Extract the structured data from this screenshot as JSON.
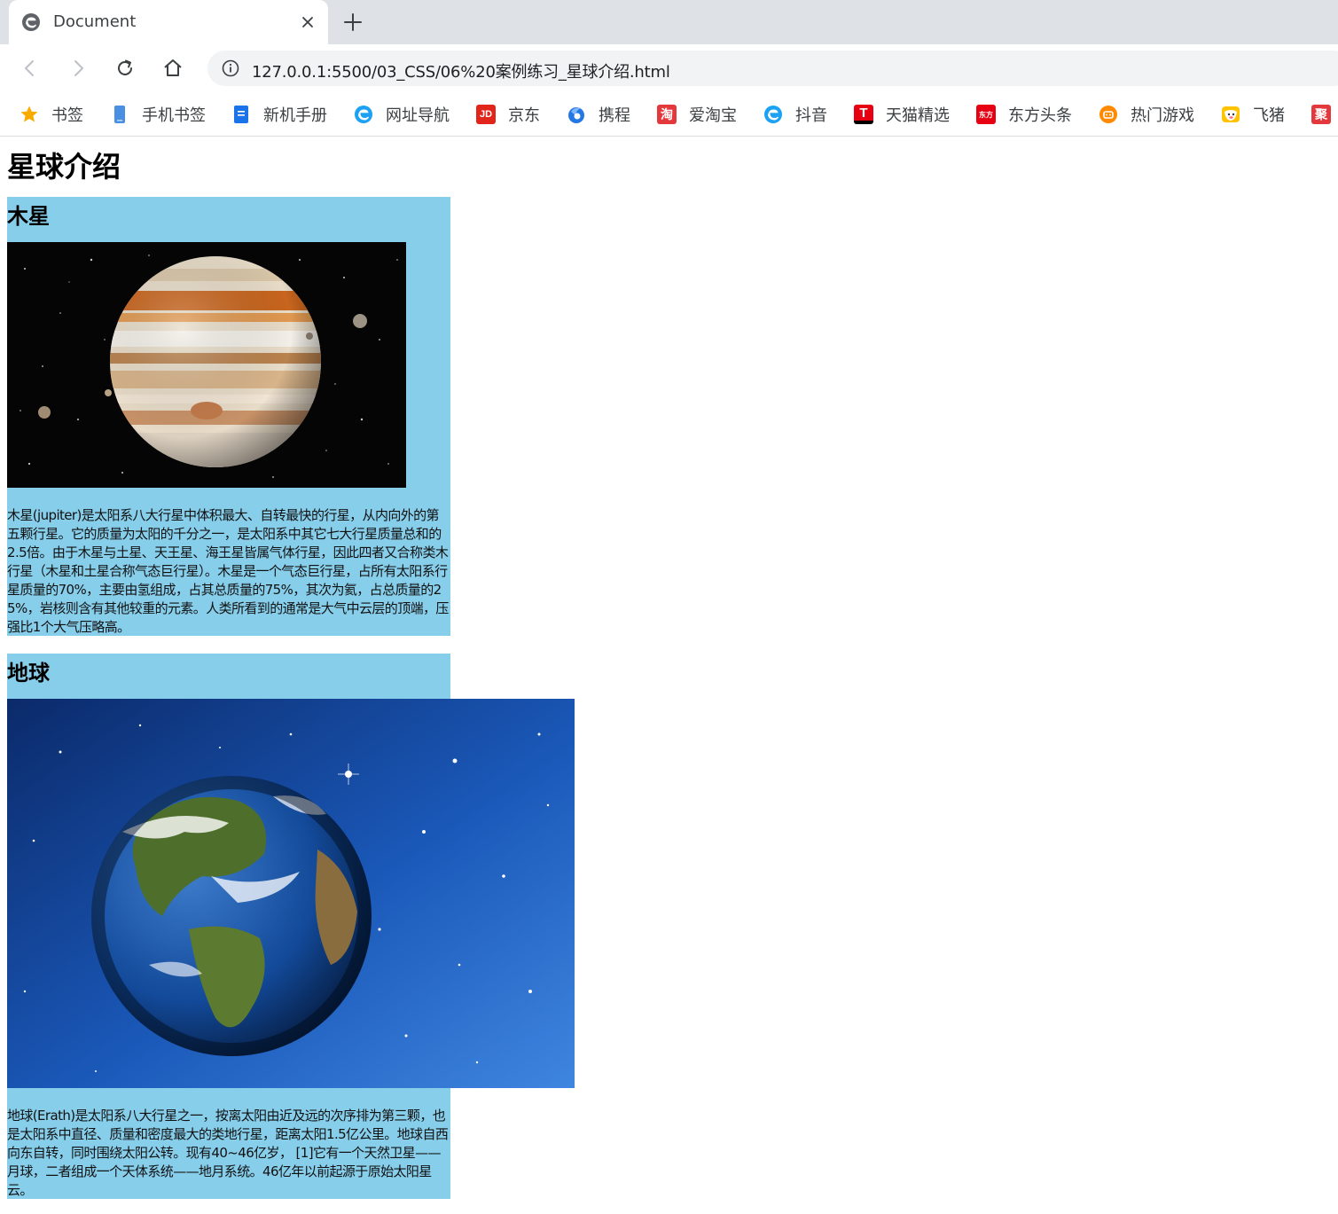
{
  "browser": {
    "tab_title": "Document",
    "url": "127.0.0.1:5500/03_CSS/06%20案例练习_星球介绍.html",
    "bookmarks": [
      {
        "label": "书签",
        "icon": "star-icon",
        "color": "#f9ab00"
      },
      {
        "label": "手机书签",
        "icon": "phone-bookmark-icon",
        "color": "#4a90e2"
      },
      {
        "label": "新机手册",
        "icon": "manual-icon",
        "color": "#1a73e8"
      },
      {
        "label": "网址导航",
        "icon": "ie-e-icon",
        "color": "#1da1f2"
      },
      {
        "label": "京东",
        "icon": "jd-icon",
        "color": "#e1251b",
        "glyph": "JD"
      },
      {
        "label": "携程",
        "icon": "ctrip-icon",
        "color": "#2577e3"
      },
      {
        "label": "爱淘宝",
        "icon": "taobao-icon",
        "color": "#e4393c",
        "glyph": "淘"
      },
      {
        "label": "抖音",
        "icon": "ie-e-icon",
        "color": "#1da1f2"
      },
      {
        "label": "天猫精选",
        "icon": "tmall-icon",
        "color": "#e60012",
        "glyph": "T"
      },
      {
        "label": "东方头条",
        "icon": "dftt-icon",
        "color": "#e60012",
        "glyph": "东方"
      },
      {
        "label": "热门游戏",
        "icon": "game-icon",
        "color": "#ff8a00"
      },
      {
        "label": "飞猪",
        "icon": "fliggy-icon",
        "color": "#ffc300"
      },
      {
        "label": "",
        "icon": "juhuasuan-icon",
        "color": "#e4393c",
        "glyph": "聚"
      }
    ]
  },
  "page": {
    "title": "星球介绍",
    "planets": [
      {
        "name": "木星",
        "image": "jupiter-image",
        "description": "木星(jupiter)是太阳系八大行星中体积最大、自转最快的行星，从内向外的第五颗行星。它的质量为太阳的千分之一，是太阳系中其它七大行星质量总和的2.5倍。由于木星与土星、天王星、海王星皆属气体行星，因此四者又合称类木行星（木星和土星合称气态巨行星）。木星是一个气态巨行星，占所有太阳系行星质量的70%，主要由氢组成，占其总质量的75%，其次为氦，占总质量的25%，岩核则含有其他较重的元素。人类所看到的通常是大气中云层的顶端，压强比1个大气压略高。"
      },
      {
        "name": "地球",
        "image": "earth-image",
        "description": "地球(Erath)是太阳系八大行星之一，按离太阳由近及远的次序排为第三颗，也是太阳系中直径、质量和密度最大的类地行星，距离太阳1.5亿公里。地球自西向东自转，同时围绕太阳公转。现有40~46亿岁， [1]它有一个天然卫星——月球，二者组成一个天体系统——地月系统。46亿年以前起源于原始太阳星云。"
      }
    ]
  },
  "colors": {
    "card_background": "#87ceeb",
    "tabstrip": "#dee1e6",
    "omnibox": "#f1f3f4"
  }
}
